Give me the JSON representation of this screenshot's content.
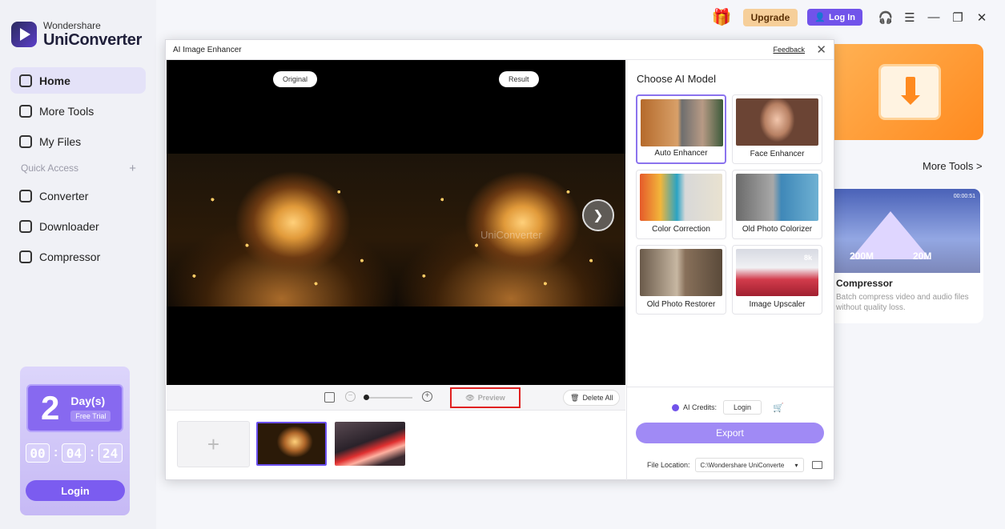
{
  "app": {
    "brand": "Wondershare",
    "product": "UniConverter"
  },
  "sidebar": {
    "items": [
      {
        "label": "Home",
        "icon": "home-icon"
      },
      {
        "label": "More Tools",
        "icon": "toolbox-icon"
      },
      {
        "label": "My Files",
        "icon": "file-icon"
      }
    ],
    "quick_access": "Quick Access",
    "quick_items": [
      {
        "label": "Converter",
        "icon": "converter-icon"
      },
      {
        "label": "Downloader",
        "icon": "downloader-icon"
      },
      {
        "label": "Compressor",
        "icon": "compressor-icon"
      }
    ]
  },
  "trial": {
    "days_num": "2",
    "days_label": "Day(s)",
    "free_trial": "Free Trial",
    "hours": "00",
    "minutes": "04",
    "seconds": "24",
    "login": "Login"
  },
  "topbar": {
    "upgrade": "Upgrade",
    "login": "Log In"
  },
  "background": {
    "more_tools": "More Tools >",
    "compressor": {
      "title": "Compressor",
      "desc": "Batch compress video and audio files without quality loss.",
      "size_from": "200M",
      "size_to": "20M",
      "time": "00:00:51"
    }
  },
  "dialog": {
    "title": "AI Image Enhancer",
    "feedback": "Feedback",
    "original_label": "Original",
    "result_label": "Result",
    "watermark": "UniConverter",
    "preview_button": "Preview",
    "delete_all": "Delete All",
    "choose_model": "Choose AI Model",
    "models": [
      {
        "label": "Auto Enhancer"
      },
      {
        "label": "Face Enhancer"
      },
      {
        "label": "Color Correction"
      },
      {
        "label": "Old Photo Colorizer"
      },
      {
        "label": "Old Photo Restorer"
      },
      {
        "label": "Image Upscaler"
      }
    ],
    "upscale_tag": "8k",
    "credits_label": "AI Credits:",
    "credits_login": "Login",
    "export": "Export",
    "file_location_label": "File Location:",
    "file_location_value": "C:\\Wondershare UniConverte"
  },
  "colors": {
    "accent": "#7153ea",
    "highlight_border": "#e02020",
    "export_button": "#a08af5"
  }
}
